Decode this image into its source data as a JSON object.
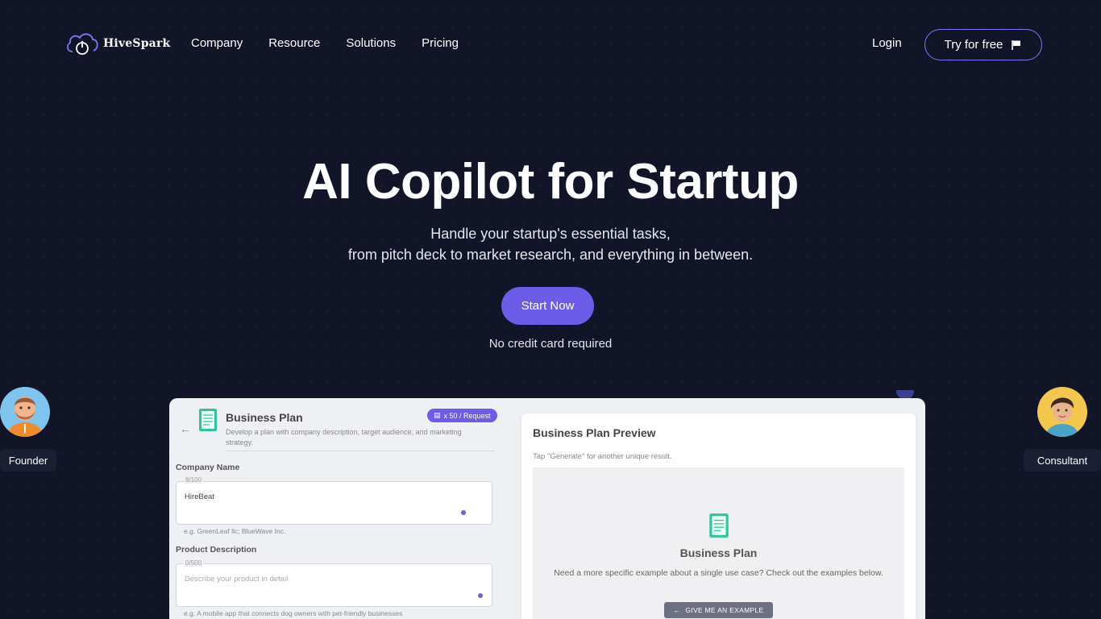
{
  "nav": {
    "brand": "HiveSpark",
    "links": [
      "Company",
      "Resource",
      "Solutions",
      "Pricing"
    ],
    "login": "Login",
    "try_button": "Try for free"
  },
  "hero": {
    "title": "AI Copilot for Startup",
    "subtitle_line1": "Handle your startup's essential tasks,",
    "subtitle_line2": "from pitch deck to market research, and everything in between.",
    "cta": "Start Now",
    "note": "No credit card required"
  },
  "personas": {
    "left": "Founder",
    "right": "Consultant"
  },
  "app": {
    "tool_title": "Business Plan",
    "tool_desc": "Develop a plan with company description, target audience, and marketing strategy.",
    "credit_badge": "x 50 / Request",
    "company_name": {
      "label": "Company Name",
      "counter": "8/100",
      "value": "HireBeat",
      "hint": "e.g. GreenLeaf llc; BlueWave Inc."
    },
    "product_description": {
      "label": "Product Description",
      "counter": "0/500",
      "placeholder": "Describe your product in detail",
      "hint": "e.g. A mobile app that connects dog owners with pet-friendly businesses"
    },
    "preview": {
      "title": "Business Plan Preview",
      "subtitle": "Tap \"Generate\" for another unique result.",
      "card_title": "Business Plan",
      "card_text": "Need a more specific example about a single use case? Check out the examples below.",
      "example_button": "GIVE ME AN EXAMPLE"
    }
  },
  "colors": {
    "background": "#111527",
    "accent": "#6c5ce7"
  }
}
